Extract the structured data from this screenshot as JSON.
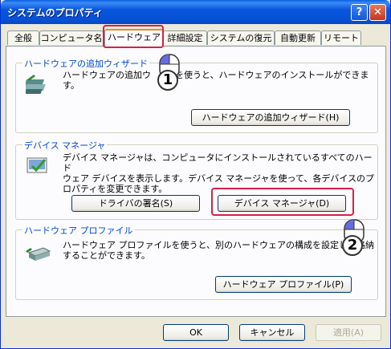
{
  "window": {
    "title": "システムのプロパティ",
    "help_glyph": "?",
    "close_glyph": "✕"
  },
  "tabs": [
    {
      "label": "全般"
    },
    {
      "label": "コンピュータ名"
    },
    {
      "label": "ハードウェア"
    },
    {
      "label": "詳細設定"
    },
    {
      "label": "システムの復元"
    },
    {
      "label": "自動更新"
    },
    {
      "label": "リモート"
    }
  ],
  "groups": {
    "wizard": {
      "label": "ハードウェアの追加ウィザード",
      "desc_line1": "ハードウェアの追加ウ",
      "desc_line1b": "を使うと、ハードウェアのインストールができま",
      "desc_line2": "す。",
      "button": "ハードウェアの追加ウィザード(H)"
    },
    "device": {
      "label": "デバイス マネージャ",
      "desc_line1": "デバイス マネージャは、コンピュータにインストールされているすべてのハード",
      "desc_line2": "ウェア デバイスを表示します。デバイス マネージャを使って、各デバイスのプ",
      "desc_line3": "ロパティを変更できます。",
      "button_sign": "ドライバの署名(S)",
      "button_manager": "デバイス マネージャ(D)"
    },
    "profile": {
      "label": "ハードウェア プロファイル",
      "desc_line1": "ハードウェア プロファイルを使うと、別のハードウェアの構成を設定し、格納",
      "desc_line2": "することができます。",
      "button": "ハードウェア プロファイル(P)"
    }
  },
  "footer": {
    "ok": "OK",
    "cancel": "キャンセル",
    "apply": "適用(A)"
  },
  "markers": {
    "step1": "1",
    "step2": "2"
  },
  "colors": {
    "accent": "#D4204A",
    "group_label": "#0046D5",
    "title_bar": "#0855DD"
  }
}
